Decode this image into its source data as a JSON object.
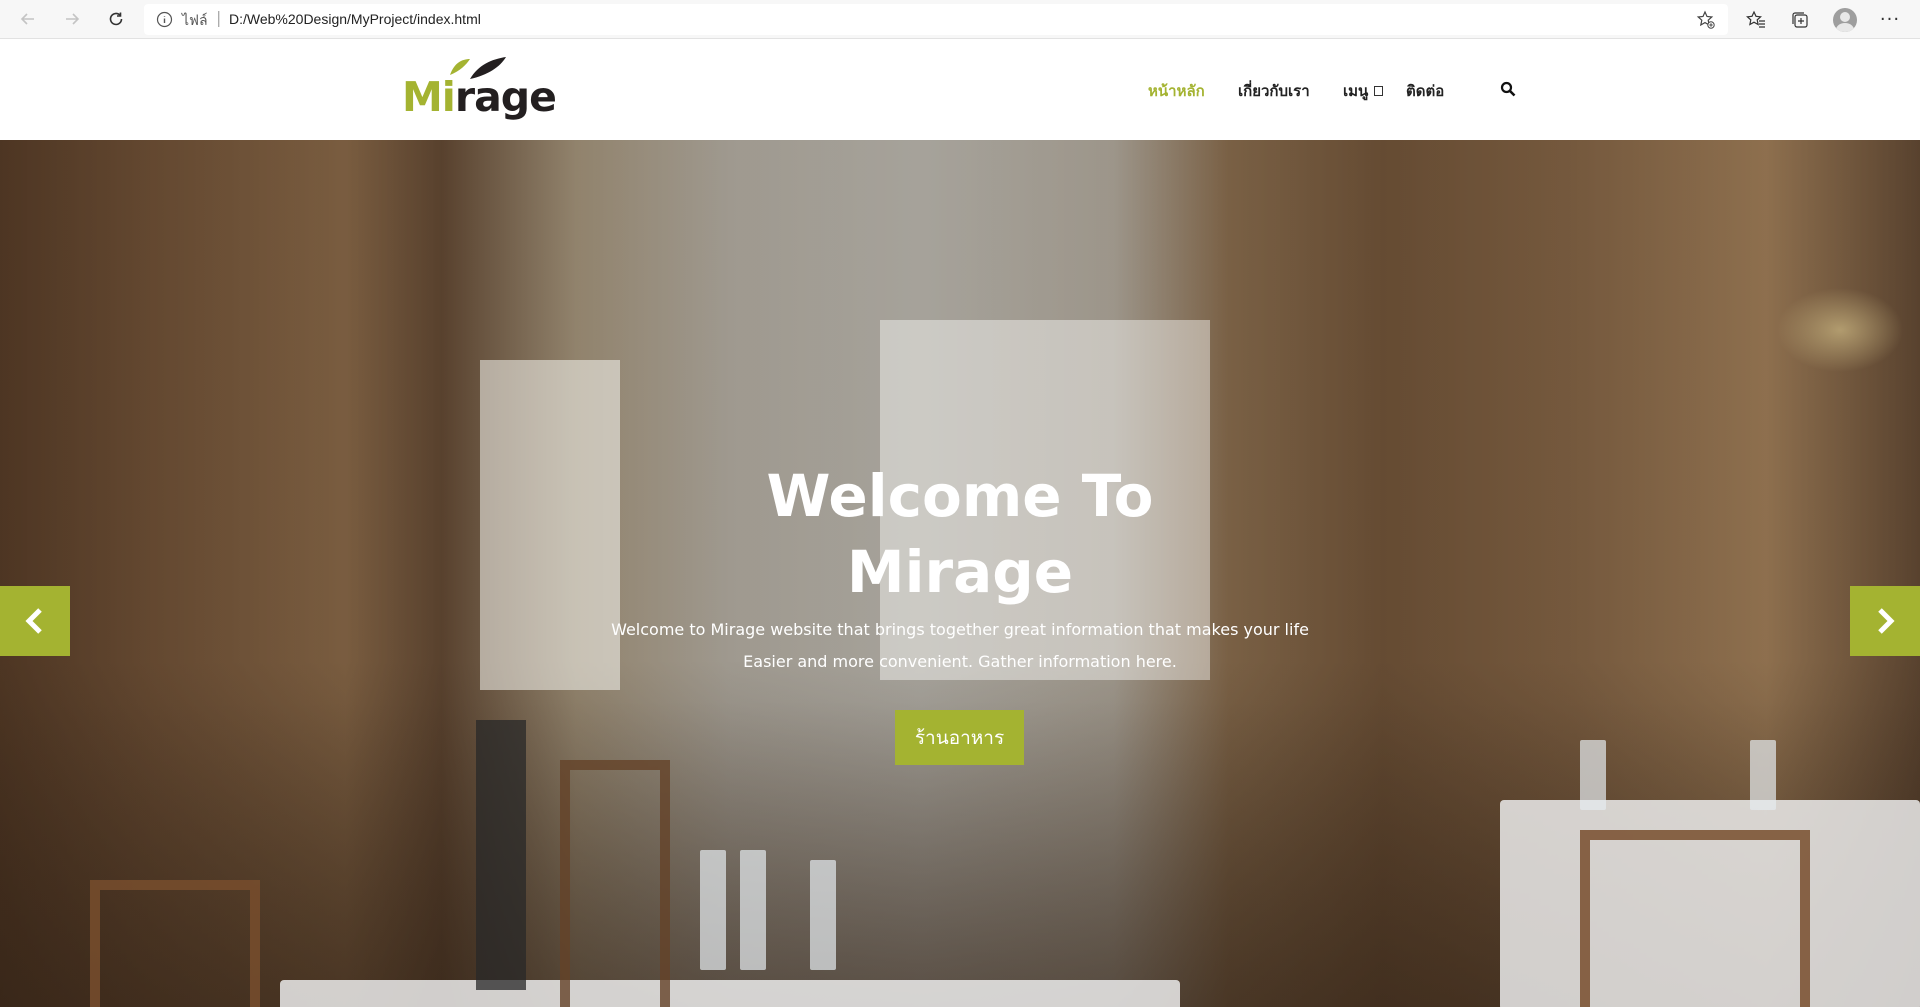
{
  "browser": {
    "scheme_label": "ไฟล์",
    "separator": "|",
    "url": "D:/Web%20Design/MyProject/index.html"
  },
  "site": {
    "logo": {
      "part1": "Mi",
      "part2": "rage"
    },
    "nav": {
      "home": "หน้าหลัก",
      "about": "เกี่ยวกับเรา",
      "menu": "เมนู",
      "contact": "ติดต่อ"
    }
  },
  "hero": {
    "title_line1": "Welcome To",
    "title_line2": "Mirage",
    "subtitle_line1": "Welcome to Mirage website that brings together great information that makes your life",
    "subtitle_line2": "Easier and more convenient. Gather information here.",
    "cta_label": "ร้านอาหาร"
  },
  "colors": {
    "accent": "#a4b331",
    "dark": "#231f20"
  }
}
